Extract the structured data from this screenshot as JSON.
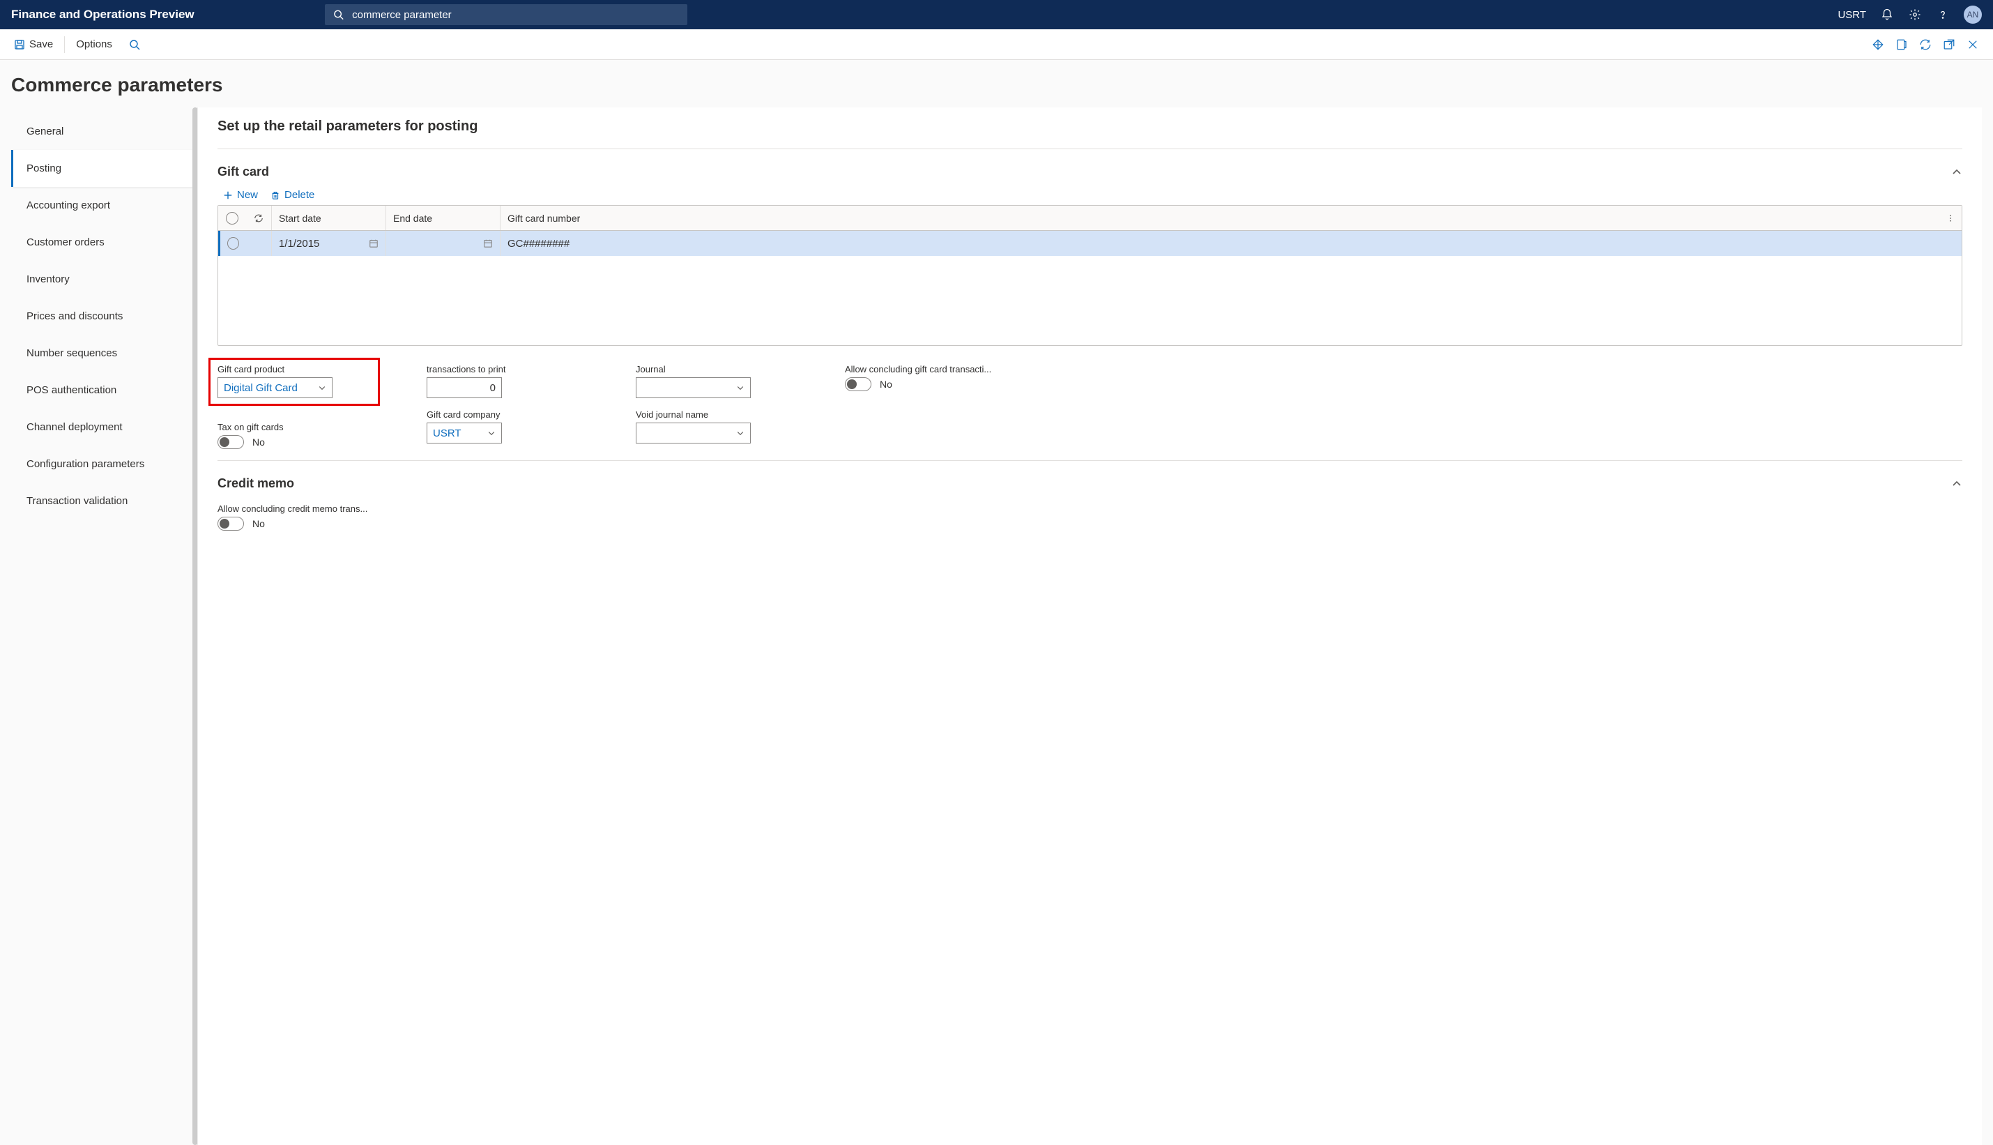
{
  "header": {
    "app_title": "Finance and Operations Preview",
    "search_value": "commerce parameter",
    "company": "USRT",
    "avatar_initials": "AN"
  },
  "actionbar": {
    "save": "Save",
    "options": "Options"
  },
  "page": {
    "title": "Commerce parameters"
  },
  "sidebar_tabs": [
    "General",
    "Posting",
    "Accounting export",
    "Customer orders",
    "Inventory",
    "Prices and discounts",
    "Number sequences",
    "POS authentication",
    "Channel deployment",
    "Configuration parameters",
    "Transaction validation"
  ],
  "main": {
    "section_title": "Set up the retail parameters for posting",
    "gift_card": {
      "heading": "Gift card",
      "toolbar": {
        "new": "New",
        "delete": "Delete"
      },
      "columns": {
        "start_date": "Start date",
        "end_date": "End date",
        "number": "Gift card number"
      },
      "row": {
        "start_date": "1/1/2015",
        "end_date": "",
        "number": "GC########"
      },
      "fields": {
        "gift_card_product_label": "Gift card product",
        "gift_card_product_value": "Digital Gift Card",
        "tax_on_gift_cards_label": "Tax on gift cards",
        "tax_on_gift_cards_value": "No",
        "transactions_to_print_label": "transactions to print",
        "transactions_to_print_value": "0",
        "gift_card_company_label": "Gift card company",
        "gift_card_company_value": "USRT",
        "journal_label": "Journal",
        "journal_value": "",
        "void_journal_label": "Void journal name",
        "void_journal_value": "",
        "allow_concluding_label": "Allow concluding gift card transacti...",
        "allow_concluding_value": "No"
      }
    },
    "credit_memo": {
      "heading": "Credit memo",
      "allow_concluding_label": "Allow concluding credit memo trans...",
      "allow_concluding_value": "No"
    }
  }
}
